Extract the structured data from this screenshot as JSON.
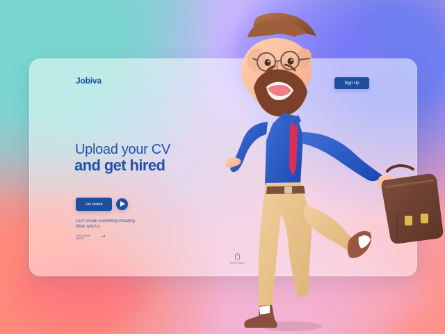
{
  "brand": {
    "name": "Jobiva"
  },
  "header": {
    "signup_label": "Sign Up"
  },
  "hero": {
    "headline_line_1": "Upload your CV",
    "headline_line_2": "and get hired",
    "cta_label": "Get started",
    "subtext": "Les't create something Amazing Work with Us",
    "discover_label": "DISCOVER\nMORE",
    "scroll_label": "Scroll Down"
  },
  "icons": {
    "play": "play-icon",
    "arrow": "arrow-right-icon",
    "mouse": "mouse-icon"
  },
  "colors": {
    "primary": "#1f4f9c",
    "text": "#2052a7",
    "card": "#ffffff"
  }
}
